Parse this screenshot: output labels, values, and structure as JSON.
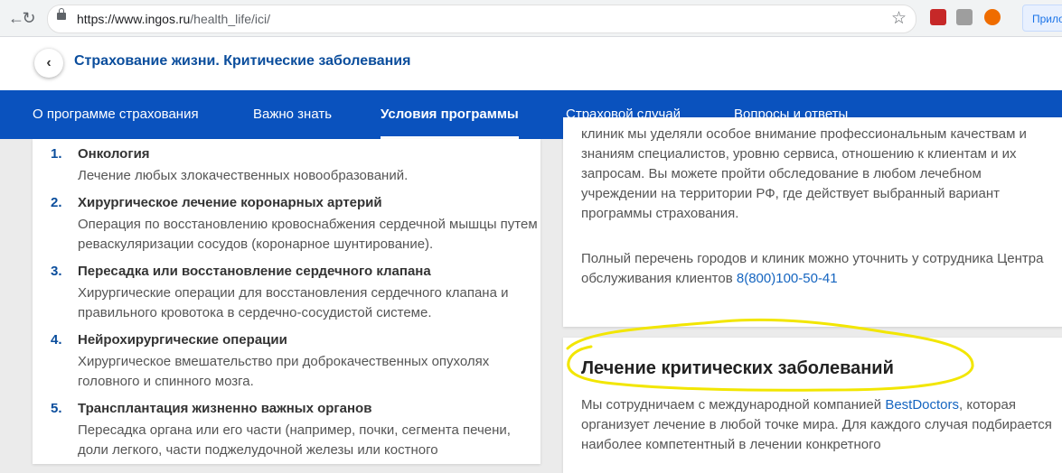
{
  "browser": {
    "url_host": "https://www.ingos.ru",
    "url_path": "/health_life/ici/",
    "profile_label": "Прило"
  },
  "header": {
    "title": "Страхование жизни. Критические заболевания"
  },
  "tabs": [
    {
      "label": "О программе страхования"
    },
    {
      "label": "Важно знать"
    },
    {
      "label": "Условия программы"
    },
    {
      "label": "Страховой случай"
    },
    {
      "label": "Вопросы и ответы"
    }
  ],
  "diseases": [
    {
      "num": "1.",
      "title": "Онкология",
      "desc": "Лечение любых злокачественных новообразований."
    },
    {
      "num": "2.",
      "title": "Хирургическое лечение коронарных артерий",
      "desc": "Операция по восстановлению кровоснабжения сердечной мышцы путем реваскуляризации сосудов (коронарное шунтирование)."
    },
    {
      "num": "3.",
      "title": "Пересадка или восстановление сердечного клапана",
      "desc": "Хирургические операции для восстановления сердечного клапана и правильного кровотока в сердечно-сосудистой системе."
    },
    {
      "num": "4.",
      "title": "Нейрохирургические операции",
      "desc": "Хирургическое вмешательство при доброкачественных опухолях головного и спинного мозга."
    },
    {
      "num": "5.",
      "title": "Трансплантация жизненно важных органов",
      "desc": "Пересадка органа или его части (например, почки, сегмента печени, доли легкого, части поджелудочной железы или костного"
    }
  ],
  "clinics_card": {
    "para1": "клиник мы уделяли особое внимание профессиональным качествам и знаниям специалистов, уровню сервиса, отношению к клиентам и их запросам. Вы можете пройти обследование в любом лечебном учреждении на территории РФ, где действует выбранный вариант программы страхования.",
    "para2_text": "Полный перечень городов и клиник можно уточнить у сотрудника Центра обслуживания клиентов",
    "phone": "8(800)100-50-41"
  },
  "treatment_card": {
    "title": "Лечение критических заболеваний",
    "text_before": "Мы сотрудничаем с международной компанией",
    "link": "BestDoctors",
    "text_after": ", которая организует лечение в любой точке мира. Для каждого случая подбирается наиболее компетентный в лечении конкретного"
  },
  "colors": {
    "brand_blue": "#0a52be",
    "title_blue": "#0a4d9c",
    "link_blue": "#1565c0",
    "highlight": "#f2e600"
  }
}
